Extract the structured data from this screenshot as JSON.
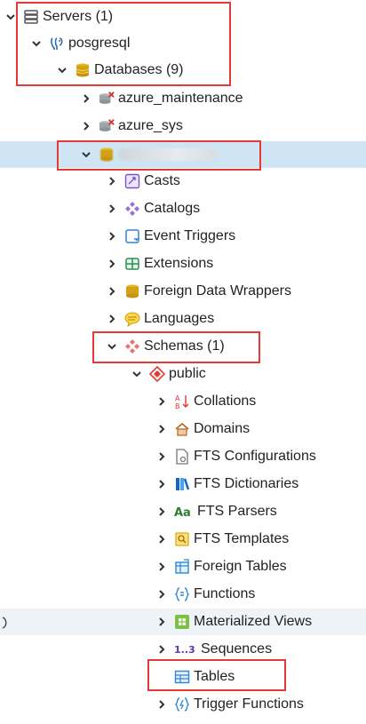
{
  "tree": {
    "servers": "Servers (1)",
    "server": "posgresql",
    "databases": "Databases (9)",
    "db_azure_maintenance": "azure_maintenance",
    "db_azure_sys": "azure_sys",
    "casts": "Casts",
    "catalogs": "Catalogs",
    "event_triggers": "Event Triggers",
    "extensions": "Extensions",
    "foreign_data_wrappers": "Foreign Data Wrappers",
    "languages": "Languages",
    "schemas": "Schemas (1)",
    "public": "public",
    "collations": "Collations",
    "domains": "Domains",
    "fts_configurations": "FTS Configurations",
    "fts_dictionaries": "FTS Dictionaries",
    "fts_parsers": "FTS Parsers",
    "fts_templates": "FTS Templates",
    "foreign_tables": "Foreign Tables",
    "functions": "Functions",
    "materialized_views": "Materialized Views",
    "sequences": "Sequences",
    "tables": "Tables",
    "trigger_functions": "Trigger Functions"
  },
  "icons": {
    "servers": "servers-icon",
    "server": "postgresql-elephant-icon",
    "database": "database-icon",
    "casts": "casts-icon",
    "catalogs": "catalogs-icon",
    "event_triggers": "event-triggers-icon",
    "extensions": "extensions-icon",
    "foreign_data_wrappers": "foreign-data-wrappers-icon",
    "languages": "languages-icon",
    "schemas": "schemas-icon",
    "public": "schema-icon",
    "collations": "collations-icon",
    "domains": "domains-icon",
    "fts_configurations": "fts-configurations-icon",
    "fts_dictionaries": "fts-dictionaries-icon",
    "fts_parsers": "fts-parsers-icon",
    "fts_templates": "fts-templates-icon",
    "foreign_tables": "foreign-tables-icon",
    "functions": "functions-icon",
    "materialized_views": "materialized-views-icon",
    "sequences": "sequences-icon",
    "tables": "tables-icon",
    "trigger_functions": "trigger-functions-icon"
  },
  "colors": {
    "highlight": "#e53935",
    "selected_row": "#cfe5f3",
    "db_icon": "#d4a017",
    "accent_purple": "#8e5bd6",
    "accent_blue": "#2f86d6"
  }
}
